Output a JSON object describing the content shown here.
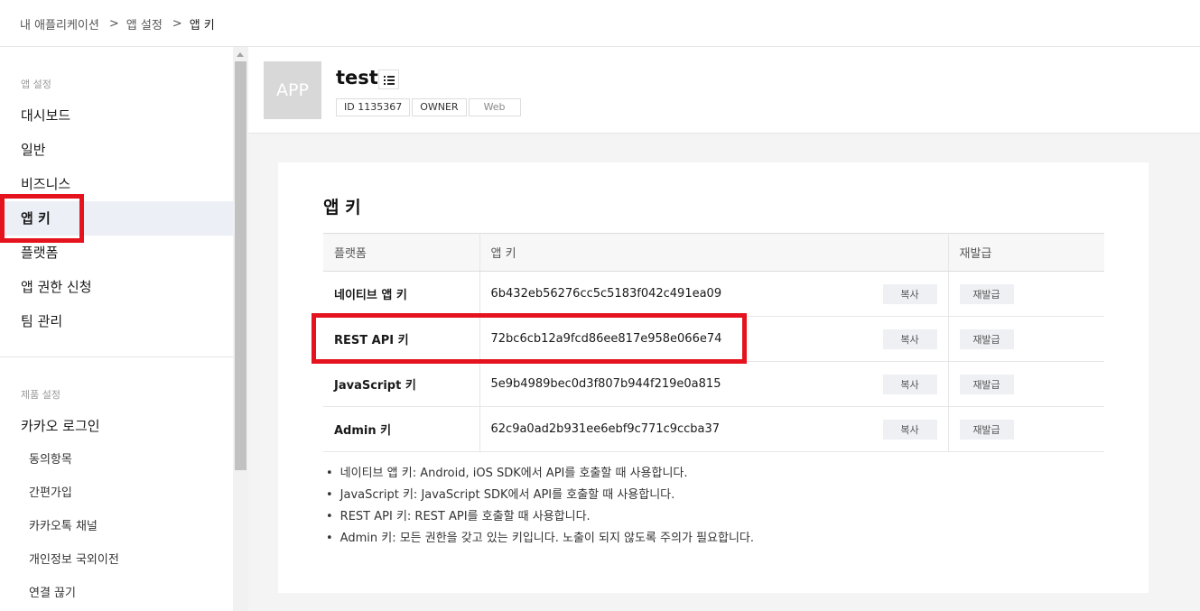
{
  "breadcrumb": {
    "items": [
      "내 애플리케이션",
      "앱 설정",
      "앱 키"
    ],
    "separator": ">"
  },
  "sidebar": {
    "section_app": "앱 설정",
    "app_items": [
      {
        "label": "대시보드"
      },
      {
        "label": "일반"
      },
      {
        "label": "비즈니스"
      },
      {
        "label": "앱 키",
        "active": true
      },
      {
        "label": "플랫폼"
      },
      {
        "label": "앱 권한 신청"
      },
      {
        "label": "팀 관리"
      }
    ],
    "section_product": "제품 설정",
    "product_item": "카카오 로그인",
    "sub_items": [
      "동의항목",
      "간편가입",
      "카카오톡 채널",
      "개인정보 국외이전",
      "연결 끊기"
    ]
  },
  "app": {
    "thumb_label": "APP",
    "name": "test",
    "tags": [
      "ID 1135367",
      "OWNER",
      "Web"
    ]
  },
  "keys": {
    "title": "앱 키",
    "columns": [
      "플랫폼",
      "앱 키",
      "재발급"
    ],
    "copy_label": "복사",
    "reissue_label": "재발급",
    "rows": [
      {
        "platform": "네이티브 앱 키",
        "key": "6b432eb56276cc5c5183f042c491ea09"
      },
      {
        "platform": "REST API 키",
        "key": "72bc6cb12a9fcd86ee817e958e066e74"
      },
      {
        "platform": "JavaScript 키",
        "key": "5e9b4989bec0d3f807b944f219e0a815"
      },
      {
        "platform": "Admin 키",
        "key": "62c9a0ad2b931ee6ebf9c771c9ccba37"
      }
    ],
    "notes": [
      "네이티브 앱 키: Android, iOS SDK에서 API를 호출할 때 사용합니다.",
      "JavaScript 키: JavaScript SDK에서 API를 호출할 때 사용합니다.",
      "REST API 키: REST API를 호출할 때 사용합니다.",
      "Admin 키: 모든 권한을 갖고 있는 키입니다. 노출이 되지 않도록 주의가 필요합니다."
    ]
  },
  "colors": {
    "highlight": "#e5131d",
    "active_bg": "#eceff5",
    "content_bg": "#f4f4f4"
  }
}
